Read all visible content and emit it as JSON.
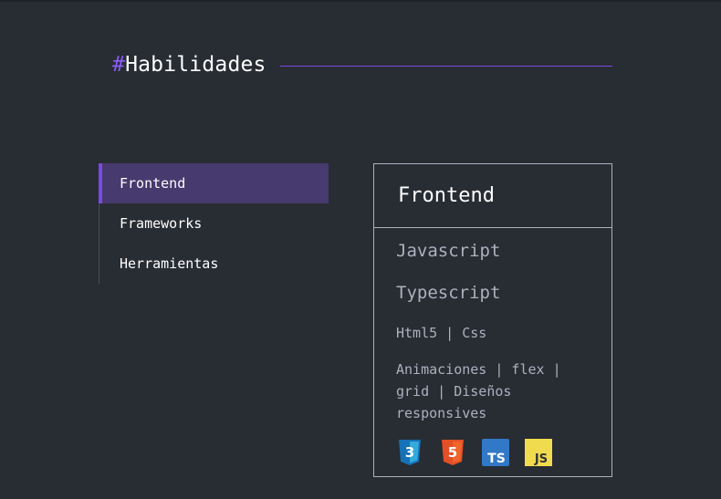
{
  "section": {
    "hash": "#",
    "title": "Habilidades"
  },
  "tabs": [
    {
      "label": "Frontend",
      "active": true
    },
    {
      "label": "Frameworks",
      "active": false
    },
    {
      "label": "Herramientas",
      "active": false
    }
  ],
  "card": {
    "title": "Frontend",
    "skills": [
      "Javascript",
      "Typescript",
      "Html5 | Css",
      "Animaciones | flex | grid | Diseños responsives"
    ],
    "icons": [
      {
        "name": "css3-icon",
        "label": "3",
        "color": "#1572b6"
      },
      {
        "name": "html5-icon",
        "label": "5",
        "color": "#e34f26"
      },
      {
        "name": "typescript-icon",
        "label": "TS",
        "color": "#3178c6"
      },
      {
        "name": "javascript-icon",
        "label": "JS",
        "color": "#f0db4f"
      }
    ]
  },
  "colors": {
    "background": "#282c33",
    "accent": "#7b4ae2",
    "active_tab_bg": "#473a6e",
    "text_muted": "#abb2bf"
  }
}
